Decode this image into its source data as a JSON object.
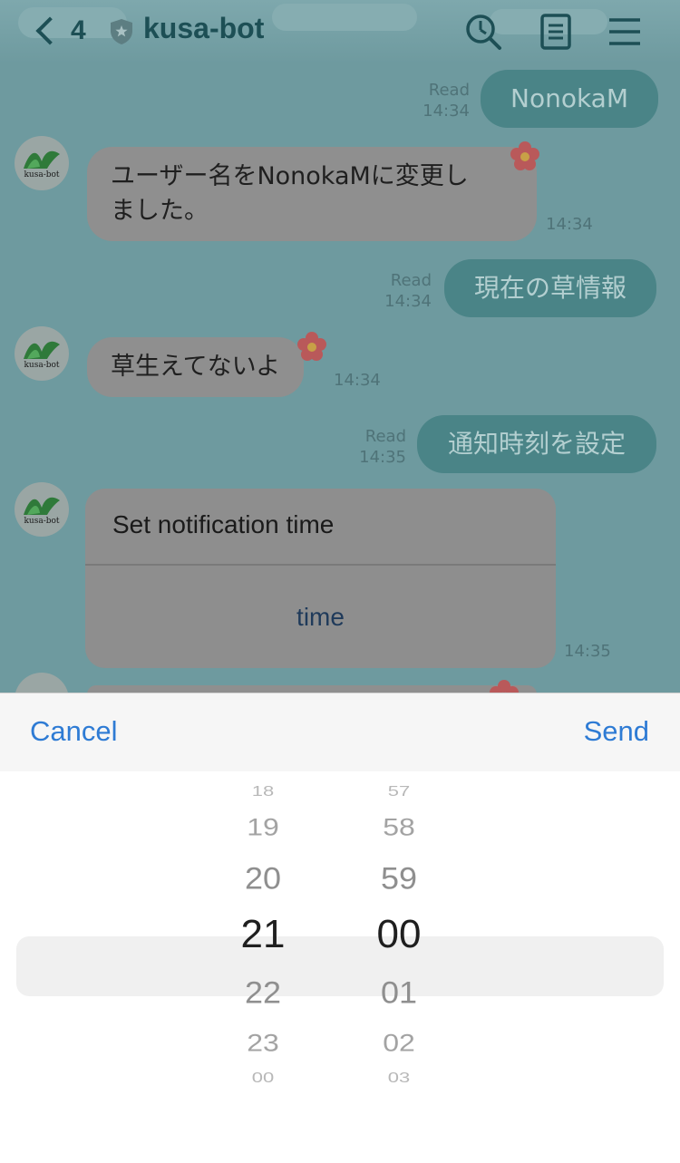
{
  "header": {
    "back_count": "4",
    "title": "kusa-bot",
    "icons": [
      "search-clock-icon",
      "notes-icon",
      "menu-icon"
    ]
  },
  "avatar_label": "kusa-bot",
  "messages": [
    {
      "dir": "out",
      "text": "NonokaM",
      "read": "Read",
      "time": "14:34"
    },
    {
      "dir": "in",
      "lines": [
        "ユーザー名をNonokaMに変更し",
        "ました。"
      ],
      "time": "14:34"
    },
    {
      "dir": "out",
      "text": "現在の草情報",
      "read": "Read",
      "time": "14:34"
    },
    {
      "dir": "in",
      "lines": [
        "草生えてないよ"
      ],
      "time": "14:34"
    },
    {
      "dir": "out",
      "text": "通知時刻を設定",
      "read": "Read",
      "time": "14:35"
    }
  ],
  "card": {
    "title": "Set notification time",
    "action": "time",
    "time": "14:35"
  },
  "picker": {
    "cancel_label": "Cancel",
    "send_label": "Send",
    "hours": [
      "18",
      "19",
      "20",
      "21",
      "22",
      "23",
      "00"
    ],
    "minutes": [
      "57",
      "58",
      "59",
      "00",
      "01",
      "02",
      "03"
    ],
    "selected_hour": "21",
    "selected_minute": "00"
  },
  "colors": {
    "accent": "#2e7bd4",
    "header_text": "#1d4f55",
    "outgoing_bubble": "#4a8487"
  }
}
